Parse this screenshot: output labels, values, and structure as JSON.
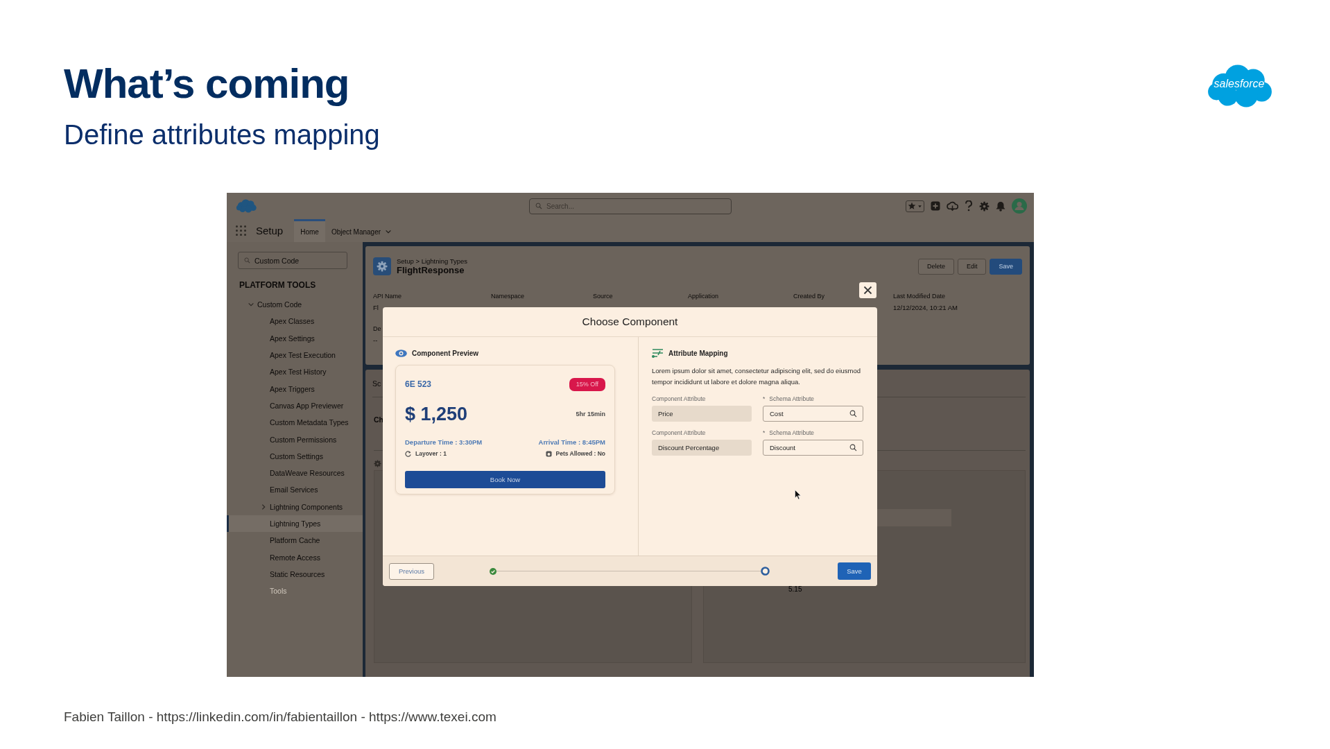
{
  "slide": {
    "title": "What’s coming",
    "subtitle": "Define attributes mapping",
    "logo_text": "salesforce",
    "footer": "Fabien Taillon - https://linkedin.com/in/fabientaillon - https://www.texei.com"
  },
  "app": {
    "header": {
      "search": {
        "placeholder": "Search..."
      }
    },
    "nav": {
      "app_name": "Setup",
      "tabs": [
        {
          "label": "Home",
          "selected": true,
          "dropdown": false
        },
        {
          "label": "Object Manager",
          "selected": false,
          "dropdown": true
        }
      ]
    },
    "sidebar": {
      "search": {
        "value": "Custom Code"
      },
      "section": "PLATFORM TOOLS",
      "items": [
        {
          "label": "Custom Code",
          "expanded": true,
          "selected": false,
          "disabled": false,
          "children": [
            {
              "label": "Apex Classes",
              "selected": false,
              "disabled": false
            },
            {
              "label": "Apex Settings",
              "selected": false,
              "disabled": false
            },
            {
              "label": "Apex Test Execution",
              "selected": false,
              "disabled": false
            },
            {
              "label": "Apex Test History",
              "selected": false,
              "disabled": false
            },
            {
              "label": "Apex Triggers",
              "selected": false,
              "disabled": false
            },
            {
              "label": "Canvas App Previewer",
              "selected": false,
              "disabled": false
            },
            {
              "label": "Custom Metadata Types",
              "selected": false,
              "disabled": false
            },
            {
              "label": "Custom Permissions",
              "selected": false,
              "disabled": false
            },
            {
              "label": "Custom Settings",
              "selected": false,
              "disabled": false
            },
            {
              "label": "DataWeave Resources",
              "selected": false,
              "disabled": false
            },
            {
              "label": "Email Services",
              "selected": false,
              "disabled": false
            },
            {
              "label": "Lightning Components",
              "selected": false,
              "disabled": false,
              "expanded": false
            },
            {
              "label": "Lightning Types",
              "selected": true,
              "disabled": false
            },
            {
              "label": "Platform Cache",
              "selected": false,
              "disabled": false
            },
            {
              "label": "Remote Access",
              "selected": false,
              "disabled": false
            },
            {
              "label": "Static Resources",
              "selected": false,
              "disabled": false
            },
            {
              "label": "Tools",
              "selected": false,
              "disabled": true
            }
          ]
        }
      ]
    },
    "record": {
      "breadcrumb": "Setup > Lightning Types",
      "title": "FlightResponse",
      "buttons": [
        {
          "label": "Delete",
          "kind": "neutral"
        },
        {
          "label": "Edit",
          "kind": "neutral"
        },
        {
          "label": "Save",
          "kind": "brand"
        }
      ],
      "fields": [
        {
          "label": "API Name",
          "value": "Fl"
        },
        {
          "label": "Namespace"
        },
        {
          "label": "Source"
        },
        {
          "label": "Application"
        },
        {
          "label": "Created By"
        },
        {
          "label": "Last Modified Date",
          "value": "12/12/2024, 10:21 AM"
        }
      ],
      "description": {
        "label": "De",
        "value": "--"
      }
    },
    "detail": {
      "tab": "Sc",
      "heading": "Ch",
      "reading": "5.15"
    }
  },
  "modal": {
    "title": "Choose Component",
    "preview": {
      "heading": "Component Preview",
      "flight": "6E 523",
      "badge": "15% Off",
      "price": "$ 1,250",
      "duration": "5hr 15min",
      "departure": "Departure Time : 3:30PM",
      "arrival": "Arrival Time : 8:45PM",
      "layover": "Layover : 1",
      "pets": "Pets Allowed : No",
      "button": "Book Now"
    },
    "mapping": {
      "heading": "Attribute Mapping",
      "description": "Lorem ipsum dolor sit amet, consectetur adipiscing elit, sed do eiusmod tempor incididunt ut labore et dolore magna aliqua.",
      "rows": [
        {
          "component_label": "Component Attribute",
          "component_value": "Price",
          "schema_marker": "*",
          "schema_label": "Schema Attribute",
          "schema_value": "Cost"
        },
        {
          "component_label": "Component Attribute",
          "component_value": "Discount Percentage",
          "schema_marker": "*",
          "schema_label": "Schema Attribute",
          "schema_value": "Discount"
        }
      ]
    },
    "footer": {
      "previous": "Previous",
      "steps": [
        {
          "kind": "complete"
        },
        {
          "kind": "current"
        }
      ],
      "save": "Save"
    }
  }
}
